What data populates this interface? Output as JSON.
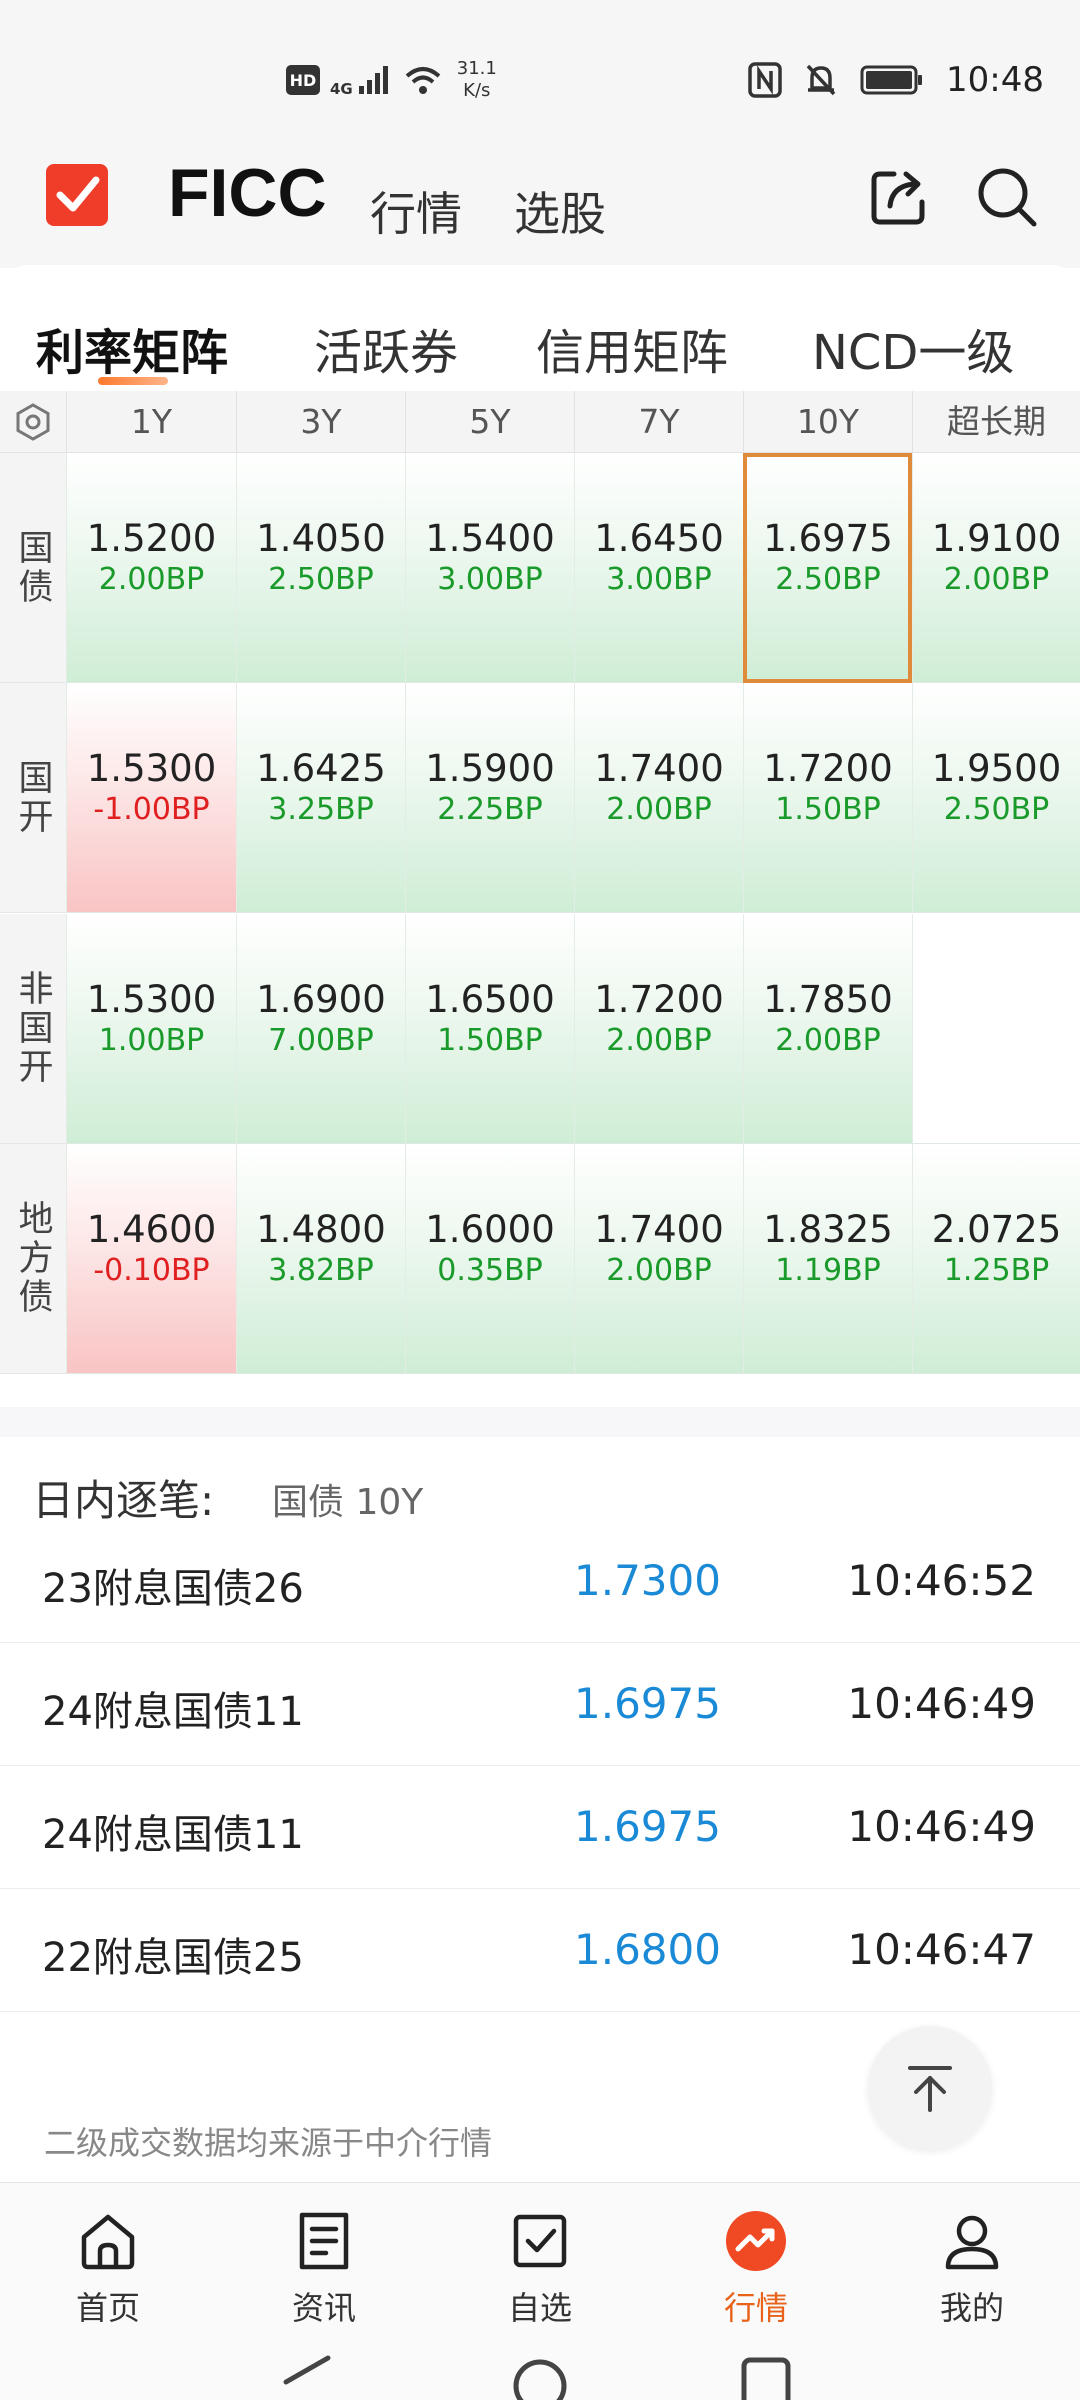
{
  "status_bar": {
    "hd": "HD",
    "network": "4G",
    "speed_value": "31.1",
    "speed_unit": "K/s",
    "time": "10:48"
  },
  "header": {
    "title": "FICC",
    "tabs": [
      "行情",
      "选股"
    ]
  },
  "subtabs": [
    "利率矩阵",
    "活跃券",
    "信用矩阵",
    "NCD一级"
  ],
  "matrix": {
    "columns": [
      "1Y",
      "3Y",
      "5Y",
      "7Y",
      "10Y",
      "超长期"
    ],
    "rows": [
      {
        "label": "国债",
        "cells": [
          {
            "value": "1.5200",
            "bp": "2.00BP"
          },
          {
            "value": "1.4050",
            "bp": "2.50BP"
          },
          {
            "value": "1.5400",
            "bp": "3.00BP"
          },
          {
            "value": "1.6450",
            "bp": "3.00BP"
          },
          {
            "value": "1.6975",
            "bp": "2.50BP"
          },
          {
            "value": "1.9100",
            "bp": "2.00BP"
          }
        ]
      },
      {
        "label": "国开",
        "cells": [
          {
            "value": "1.5300",
            "bp": "-1.00BP"
          },
          {
            "value": "1.6425",
            "bp": "3.25BP"
          },
          {
            "value": "1.5900",
            "bp": "2.25BP"
          },
          {
            "value": "1.7400",
            "bp": "2.00BP"
          },
          {
            "value": "1.7200",
            "bp": "1.50BP"
          },
          {
            "value": "1.9500",
            "bp": "2.50BP"
          }
        ]
      },
      {
        "label": "非国开",
        "cells": [
          {
            "value": "1.5300",
            "bp": "1.00BP"
          },
          {
            "value": "1.6900",
            "bp": "7.00BP"
          },
          {
            "value": "1.6500",
            "bp": "1.50BP"
          },
          {
            "value": "1.7200",
            "bp": "2.00BP"
          },
          {
            "value": "1.7850",
            "bp": "2.00BP"
          },
          {
            "value": "",
            "bp": ""
          }
        ]
      },
      {
        "label": "地方债",
        "cells": [
          {
            "value": "1.4600",
            "bp": "-0.10BP"
          },
          {
            "value": "1.4800",
            "bp": "3.82BP"
          },
          {
            "value": "1.6000",
            "bp": "0.35BP"
          },
          {
            "value": "1.7400",
            "bp": "2.00BP"
          },
          {
            "value": "1.8325",
            "bp": "1.19BP"
          },
          {
            "value": "2.0725",
            "bp": "1.25BP"
          }
        ]
      }
    ]
  },
  "intraday": {
    "title": "日内逐笔:",
    "subtitle": "国债 10Y",
    "trades": [
      {
        "name": "23附息国债26",
        "price": "1.7300",
        "time": "10:46:52"
      },
      {
        "name": "24附息国债11",
        "price": "1.6975",
        "time": "10:46:49"
      },
      {
        "name": "24附息国债11",
        "price": "1.6975",
        "time": "10:46:49"
      },
      {
        "name": "22附息国债25",
        "price": "1.6800",
        "time": "10:46:47"
      }
    ],
    "footnote": "二级成交数据均来源于中介行情"
  },
  "bottom_nav": [
    {
      "label": "首页",
      "icon": "home-icon"
    },
    {
      "label": "资讯",
      "icon": "news-icon"
    },
    {
      "label": "自选",
      "icon": "watchlist-icon"
    },
    {
      "label": "行情",
      "icon": "market-icon"
    },
    {
      "label": "我的",
      "icon": "profile-icon"
    }
  ],
  "colors": {
    "accent": "#e8621a",
    "up": "#1a9a2a",
    "down": "#e02020",
    "price_blue": "#1a8ad6"
  }
}
